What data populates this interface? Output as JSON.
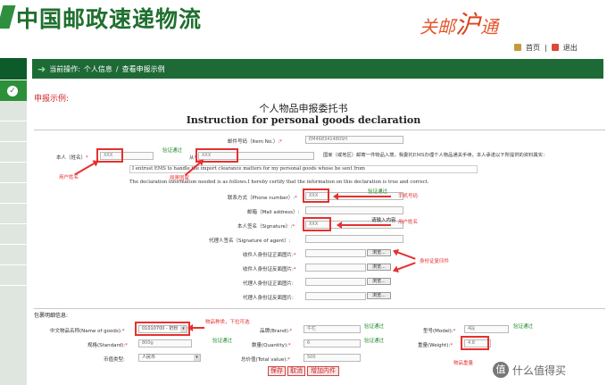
{
  "header": {
    "logo_text": "中国邮政速递物流",
    "slogan_a": "关邮",
    "slogan_b": "沪",
    "slogan_c": "通",
    "home_label": "首页",
    "logout_label": "退出"
  },
  "breadcrumb": {
    "prefix": "当前操作:",
    "item1": "个人信息",
    "sep": "/",
    "item2": "查看申报示例"
  },
  "section_label": "申报示例:",
  "form": {
    "title_cn": "个人物品申报委托书",
    "title_en": "Instruction for personal goods declaration",
    "item_no_label": "邮件号码（Item No.）:",
    "item_no_value": "EM468341480SH",
    "name_label": "本人（姓名）",
    "name_value": "XXX",
    "from_label": "从",
    "from_value": "XXX",
    "country_text": "国家（或地区）邮寄一件物品入境，我委托EMS办理个人物品通关手续，本人承诺以下所提供的资料属实：",
    "para1": "I entrust EMS to handle the import clearance matters for my personal goods whose be sent from",
    "para2": "The declaration information needed is as follows.I hereby certify that the information on this declaration is true and correct.",
    "phone_label": "联系方式（Phone number）:",
    "phone_value": "XXX",
    "mail_label": "邮箱（Mail address）:",
    "signature_label": "本人签名（Signature）:",
    "signature_value": "XXX",
    "agent_label": "代理人签名（Signature of agent）:",
    "id_front_label": "收件人身份证正面图片:",
    "id_back_label": "收件人身份证反面图片:",
    "agent_id_front_label": "代理人身份证正面图片:",
    "agent_id_back_label": "代理人身份证反面图片:",
    "browse_label": "浏览..."
  },
  "annotations": {
    "verified_1": "验证通过",
    "verified_2": "验证通过",
    "user_name": "用户姓名",
    "origin_country": "原寄国家",
    "phone_num": "手机号码",
    "please_input": "请输入内容",
    "user_name_2": "用户姓名",
    "id_photos": "身份证复印件",
    "goods_type": "物品种类，下拉可选",
    "verified_goods": "验证通过",
    "verified_brand": "验证通过",
    "verified_model": "验证通过",
    "verified_qty": "验证通过",
    "goods_weight": "物品重量"
  },
  "details": {
    "heading": "包裹明细信息:",
    "goods_name_label": "中文物品名称(Name of goods):",
    "goods_name_value": "01010700 - 奶粉",
    "brand_label": "品牌(Brand):",
    "brand_value": "牛栏",
    "model_label": "型号(Model):",
    "model_value": "4段",
    "spec_label": "规格(Standard):",
    "spec_value": "800g",
    "qty_label": "数量(Quantity):",
    "qty_value": "6",
    "weight_label": "重量(Weight):",
    "weight_value": "4.8",
    "currency_label": "币值类型:",
    "currency_value": "人民币",
    "total_label": "总价值(Total value):",
    "total_value": "500",
    "save_label": "保存",
    "cancel_label": "取消",
    "add_item_label": "增加内件"
  },
  "watermark": {
    "text": "什么值得买",
    "icon": "值"
  },
  "colors": {
    "brand_green": "#0d5a2a",
    "annotation_red": "#e63030",
    "verified_green": "#1d8a2b"
  }
}
